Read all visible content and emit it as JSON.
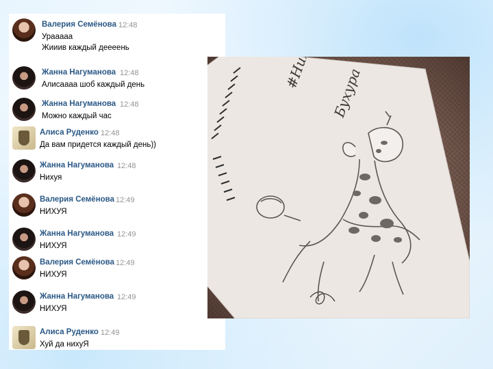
{
  "messages": [
    {
      "name": "Валерия Семёнова",
      "time": "12:48",
      "text": "Урааааа",
      "text2": "Жииив каждый деееень",
      "avatar": "valeria"
    },
    {
      "name": "Жанна Нагуманова",
      "time": "12:48",
      "text": "Алисаааа шоб каждый день",
      "avatar": "zhanna"
    },
    {
      "name": "Жанна Нагуманова",
      "time": "12:48",
      "text": "Можно каждый час",
      "avatar": "zhanna"
    },
    {
      "name": "Алиса Руденко",
      "time": "12:48",
      "text": "Да вам придется каждый день))",
      "avatar": "alisa"
    },
    {
      "name": "Жанна Нагуманова",
      "time": "12:48",
      "text": "Нихуя",
      "avatar": "zhanna"
    },
    {
      "name": "Валерия Семёнова",
      "time": "12:49",
      "text": "НИХУЯ",
      "avatar": "valeria"
    },
    {
      "name": "Жанна Нагуманова",
      "time": "12:49",
      "text": "НИХУЯ",
      "avatar": "zhanna"
    },
    {
      "name": "Валерия Семёнова",
      "time": "12:49",
      "text": "НИХУЯ",
      "avatar": "valeria"
    },
    {
      "name": "Жанна Нагуманова",
      "time": "12:49",
      "text": "НИХУЯ",
      "avatar": "zhanna"
    },
    {
      "name": "Алиса Руденко",
      "time": "12:49",
      "text": "Хуй да нихуЯ",
      "avatar": "alisa"
    }
  ],
  "photo": {
    "handwriting_line1": "#Нихуя и",
    "handwriting_line2": "Бухура"
  }
}
